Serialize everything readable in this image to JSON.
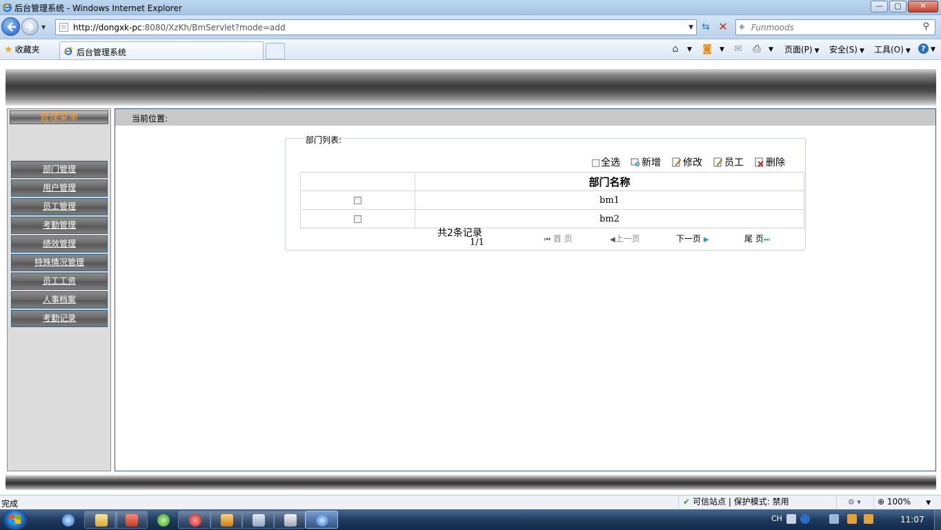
{
  "window": {
    "title": "后台管理系统 - Windows Internet Explorer",
    "controls": {
      "minimize": "—",
      "maximize": "▢",
      "close": "✕"
    }
  },
  "navbar": {
    "url_prefix": "http://dongxk-pc",
    "url_rest": ":8080/XzKh/BmServlet?mode=add",
    "search_placeholder": "Funmoods"
  },
  "cmdbar": {
    "favorites_label": "收藏夹",
    "tab_title": "后台管理系统",
    "page_menu": "页面(P)",
    "safety_menu": "安全(S)",
    "tools_menu": "工具(O)",
    "help_icon": "?"
  },
  "sidebar": {
    "header": "管理菜单",
    "items": [
      {
        "label": "部门管理"
      },
      {
        "label": "用户管理"
      },
      {
        "label": "员工管理"
      },
      {
        "label": "考勤管理"
      },
      {
        "label": "绩效管理"
      },
      {
        "label": "特殊情况管理"
      },
      {
        "label": "员工工资"
      },
      {
        "label": "人事档案"
      },
      {
        "label": "考勤记录"
      }
    ]
  },
  "main": {
    "breadcrumb": "当前位置:",
    "list_legend": "部门列表:",
    "toolbar": {
      "select_all": "全选",
      "add": "新增",
      "edit": "修改",
      "employees": "员工",
      "delete": "删除"
    },
    "table": {
      "header": "部门名称",
      "rows": [
        {
          "name": "bm1"
        },
        {
          "name": "bm2"
        }
      ]
    },
    "pager": {
      "total": "共2条记录",
      "page_info": "1/1",
      "first": "首 页",
      "prev": "上一页",
      "next": "下一页",
      "last": "尾 页"
    }
  },
  "statusbar": {
    "status": "完成",
    "zone": "可信站点 | 保护模式: 禁用",
    "zoom": "100%"
  },
  "taskbar": {
    "lang": "CH",
    "time": "11:07"
  },
  "colors": {
    "menu_header_text": "#f7a23a",
    "main_border": "#3a5e88",
    "delete_icon": "#c9261f",
    "pager_arrow_active": "#2a9ab8"
  }
}
